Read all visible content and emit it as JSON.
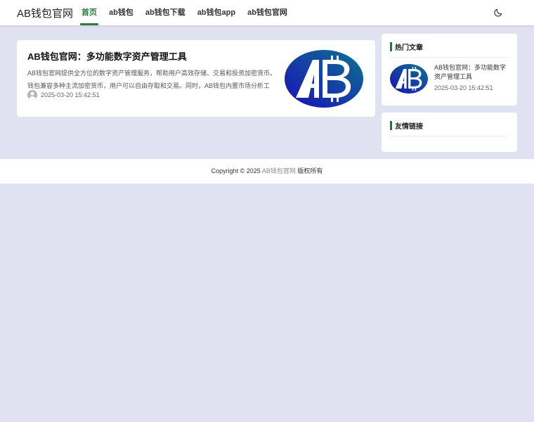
{
  "site": {
    "logo": "AB钱包官网"
  },
  "nav": [
    {
      "label": "首页",
      "active": true
    },
    {
      "label": "ab钱包",
      "active": false
    },
    {
      "label": "ab钱包下载",
      "active": false
    },
    {
      "label": "ab钱包app",
      "active": false
    },
    {
      "label": "ab钱包官网",
      "active": false
    }
  ],
  "header": {
    "theme_toggle_icon": "moon-icon"
  },
  "post": {
    "title": "AB钱包官网：多功能数字资产管理工具",
    "excerpt": "AB钱包官网提供全方位的数字资产管理服务，帮助用户高效存储、交易和投资加密货币。钱包兼容多种主流加密货币，用户可以自由存取和交易。同时，AB钱包内置市场分析工具，提供实时...",
    "date": "2025-03-20 15:42:51",
    "thumbnail_letters": "AB"
  },
  "sidebar": {
    "hot_heading": "热门文章",
    "hot_item": {
      "title": "AB钱包官网：多功能数字资产管理工具",
      "date": "2025-03-20 15:42:51"
    },
    "links_heading": "友情链接"
  },
  "footer": {
    "prefix": "Copyright © 2025 ",
    "brand": "AB钱包官网",
    "suffix": " 版权所有"
  },
  "colors": {
    "accent": "#2a7d3a",
    "background": "#e1e2f1",
    "logo_blue": "#1a1fa8",
    "logo_teal": "#0d6f8a"
  }
}
